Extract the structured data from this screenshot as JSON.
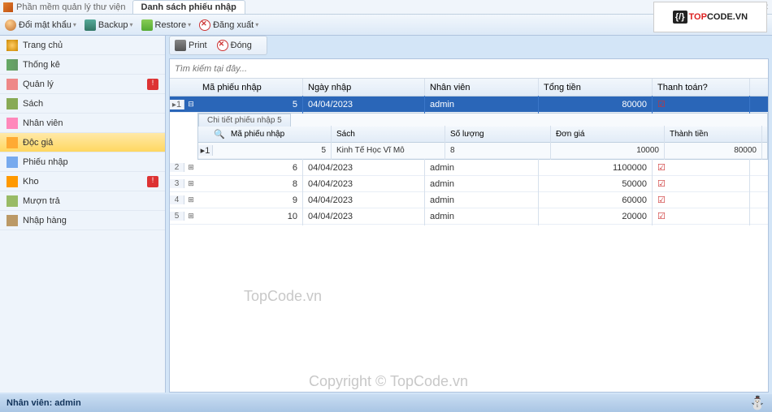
{
  "app": {
    "title": "Phần mềm quản lý thư viện",
    "active_tab": "Danh sách phiếu nhập",
    "logo_prefix": "TOP",
    "logo_suffix": "CODE.VN"
  },
  "toolbar": {
    "change_pw": "Đổi mật khẩu",
    "backup": "Backup",
    "restore": "Restore",
    "logout": "Đăng xuất"
  },
  "subtoolbar": {
    "print": "Print",
    "close": "Đóng"
  },
  "search": {
    "placeholder": "Tìm kiếm tại đây..."
  },
  "sidebar": {
    "items": [
      {
        "label": "Trang chủ"
      },
      {
        "label": "Thống kê"
      },
      {
        "label": "Quản lý",
        "badge": "!"
      },
      {
        "label": "Sách"
      },
      {
        "label": "Nhân viên"
      },
      {
        "label": "Độc giả"
      },
      {
        "label": "Phiếu nhập"
      },
      {
        "label": "Kho",
        "badge": "!"
      },
      {
        "label": "Mượn trả"
      },
      {
        "label": "Nhập hàng"
      }
    ]
  },
  "grid": {
    "headers": {
      "id": "Mã phiếu nhập",
      "date": "Ngày nhập",
      "nv": "Nhân viên",
      "total": "Tổng tiền",
      "pay": "Thanh toán?"
    },
    "rows": [
      {
        "n": "1",
        "id": "5",
        "date": "04/04/2023",
        "nv": "admin",
        "total": "80000",
        "paid": true,
        "expanded": true
      },
      {
        "n": "2",
        "id": "6",
        "date": "04/04/2023",
        "nv": "admin",
        "total": "1100000",
        "paid": true
      },
      {
        "n": "3",
        "id": "8",
        "date": "04/04/2023",
        "nv": "admin",
        "total": "50000",
        "paid": true
      },
      {
        "n": "4",
        "id": "9",
        "date": "04/04/2023",
        "nv": "admin",
        "total": "60000",
        "paid": true
      },
      {
        "n": "5",
        "id": "10",
        "date": "04/04/2023",
        "nv": "admin",
        "total": "20000",
        "paid": true
      }
    ]
  },
  "detail": {
    "tab": "Chi tiết phiếu nhập 5",
    "headers": {
      "id": "Mã phiếu nhập",
      "book": "Sách",
      "qty": "Số lượng",
      "price": "Đơn giá",
      "tt": "Thành tiền"
    },
    "rows": [
      {
        "n": "1",
        "id": "5",
        "book": "Kinh Tế Học Vĩ Mô",
        "qty": "8",
        "price": "10000",
        "tt": "80000"
      }
    ]
  },
  "status": {
    "user_label": "Nhân viên: admin"
  },
  "watermark": {
    "w1": "TopCode.vn",
    "w2": "Copyright © TopCode.vn"
  }
}
